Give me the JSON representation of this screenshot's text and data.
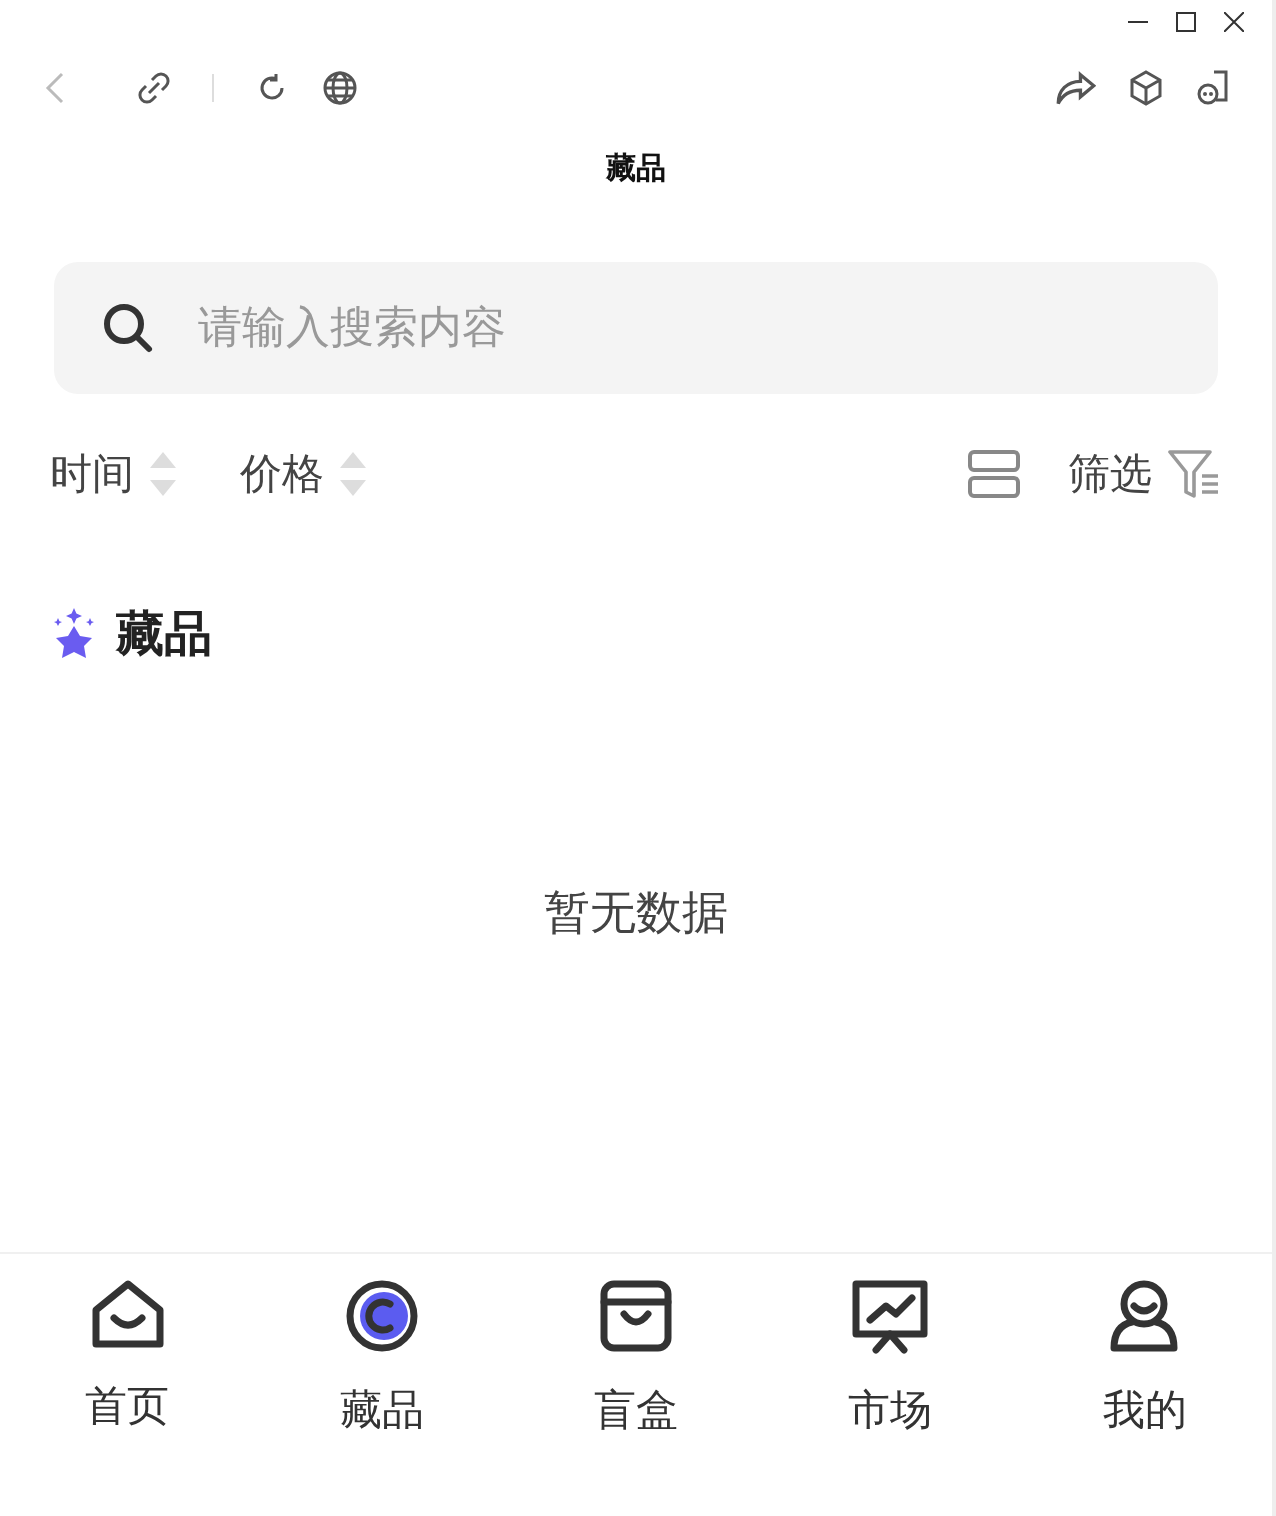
{
  "page_title": "藏品",
  "search": {
    "placeholder": "请输入搜索内容"
  },
  "sort_options": [
    {
      "label": "时间"
    },
    {
      "label": "价格"
    }
  ],
  "filter": {
    "label": "筛选"
  },
  "section": {
    "title": "藏品"
  },
  "empty_text": "暂无数据",
  "tabs": [
    {
      "label": "首页",
      "kind": "home",
      "selected": false
    },
    {
      "label": "藏品",
      "kind": "collection",
      "selected": true
    },
    {
      "label": "盲盒",
      "kind": "box",
      "selected": false
    },
    {
      "label": "市场",
      "kind": "market",
      "selected": false
    },
    {
      "label": "我的",
      "kind": "user",
      "selected": false
    }
  ]
}
